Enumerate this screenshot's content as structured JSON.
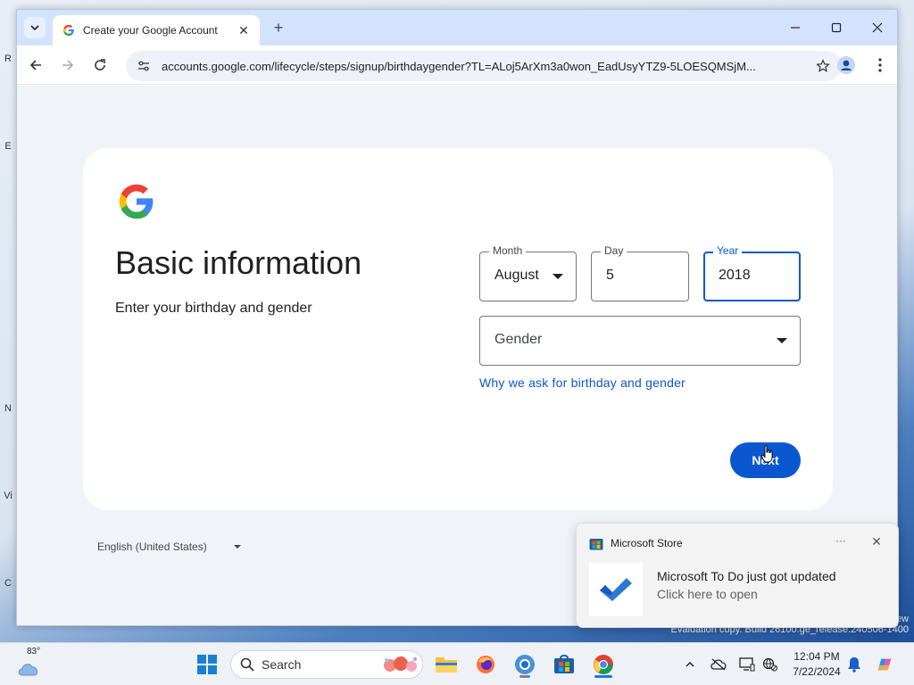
{
  "browser": {
    "tab_title": "Create your Google Account",
    "url": "accounts.google.com/lifecycle/steps/signup/birthdaygender?TL=ALoj5ArXm3a0won_EadUsyYTZ9-5LOESQMSjM..."
  },
  "signup": {
    "heading": "Basic information",
    "subheading": "Enter your birthday and gender",
    "month": {
      "label": "Month",
      "value": "August"
    },
    "day": {
      "label": "Day",
      "value": "5"
    },
    "year": {
      "label": "Year",
      "value": "2018"
    },
    "gender": {
      "placeholder": "Gender"
    },
    "why_link": "Why we ask for birthday and gender",
    "next_label": "Next",
    "language": "English (United States)"
  },
  "toast": {
    "app_name": "Microsoft Store",
    "more_label": "···",
    "title": "Microsoft To Do just got updated",
    "subtitle": "Click here to open"
  },
  "desktop": {
    "eval_text": "Evaluation copy. Build 26100.ge_release.240506-1400",
    "eval_text_top": "ew",
    "left_fragments": [
      "R",
      "E",
      "N",
      "Vi",
      "C"
    ]
  },
  "taskbar": {
    "weather_temp": "83°",
    "search_label": "Search",
    "time": "12:04 PM",
    "date": "7/22/2024",
    "pinned": [
      "start-icon",
      "file-explorer-icon",
      "firefox-icon",
      "chrome-canary-icon",
      "microsoft-store-icon",
      "chrome-icon"
    ]
  },
  "colors": {
    "accent": "#0b57d0",
    "page_bg": "#f0f4f9",
    "tab_strip": "#d3e3fd"
  }
}
